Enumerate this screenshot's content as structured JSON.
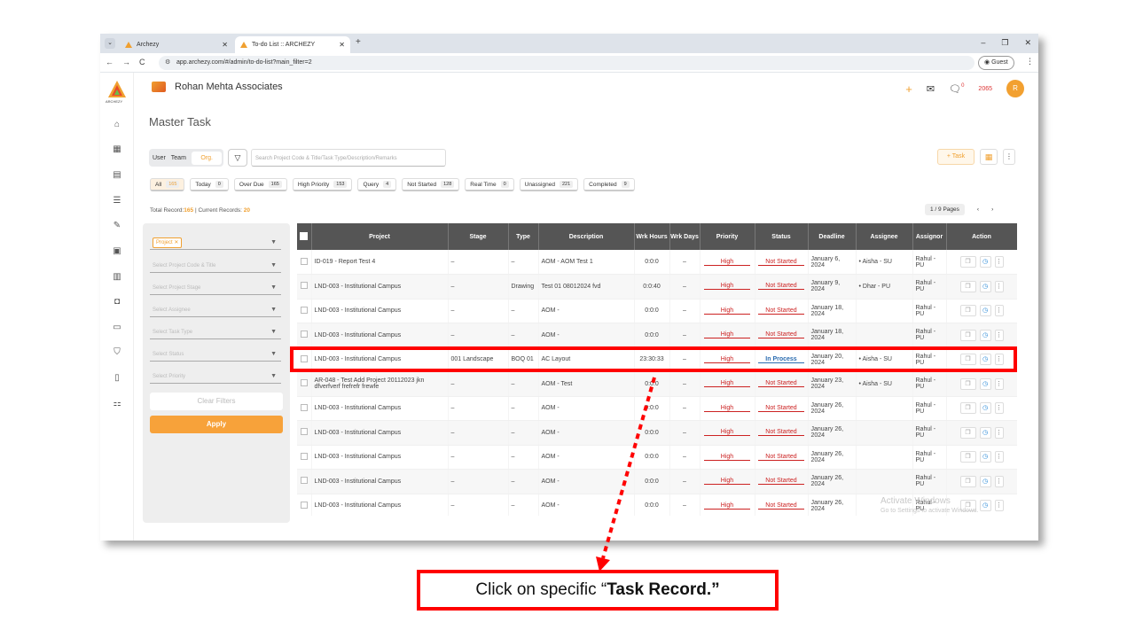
{
  "browser": {
    "tabs": [
      {
        "title": "Archezy"
      },
      {
        "title": "To-do List :: ARCHEZY"
      }
    ],
    "new_tab": "+",
    "window_controls": [
      "–",
      "❐",
      "✕"
    ],
    "url": "app.archezy.com/#/admin/to-do-list?main_filter=2",
    "guest_label": "Guest"
  },
  "app": {
    "brand_text": "ARCHEZY",
    "org_name": "Rohan Mehta Associates",
    "page_title": "Master Task",
    "notification_count": "0",
    "coins": "2065",
    "avatar_initial": "R"
  },
  "toolbar": {
    "toggle_user": "User",
    "toggle_team": "Team",
    "toggle_org": "Org.",
    "search_placeholder": "Search Project Code & Title/Task Type/Description/Remarks",
    "add_task_label": "+ Task"
  },
  "chips": [
    {
      "label": "All",
      "count": "165"
    },
    {
      "label": "Today",
      "count": "0"
    },
    {
      "label": "Over Due",
      "count": "165"
    },
    {
      "label": "High Priority",
      "count": "153"
    },
    {
      "label": "Query",
      "count": "4"
    },
    {
      "label": "Not Started",
      "count": "128"
    },
    {
      "label": "Real Time",
      "count": "0"
    },
    {
      "label": "Unassigned",
      "count": "221"
    },
    {
      "label": "Completed",
      "count": "9"
    }
  ],
  "totals": {
    "total_label": "Total Record:",
    "total_value": "165",
    "current_label": "| Current Records:",
    "current_value": "20"
  },
  "pagination": {
    "pages": "1 / 9 Pages",
    "prev": "‹",
    "next": "›"
  },
  "filters": {
    "project_tag": "Project",
    "selects": [
      "Select Project Code & Title",
      "Select Project Stage",
      "Select Assignee",
      "Select Task Type",
      "Select Status",
      "Select Priority"
    ],
    "clear_label": "Clear Filters",
    "apply_label": "Apply"
  },
  "table": {
    "headers": [
      "Project",
      "Stage",
      "Type",
      "Description",
      "Wrk Hours",
      "Wrk Days",
      "Priority",
      "Status",
      "Deadline",
      "Assignee",
      "Assignor",
      "Action"
    ],
    "rows": [
      {
        "project": "ID-019 - Report Test 4",
        "stage": "–",
        "type": "–",
        "description": "AOM - AOM Test 1",
        "hours": "0:0:0",
        "days": "–",
        "priority": "High",
        "status": "Not Started",
        "deadline": "January 6, 2024",
        "assignee": "Aisha - SU",
        "assignor": "Rahul - PU"
      },
      {
        "project": "LND-003 - Institutional Campus",
        "stage": "–",
        "type": "Drawing",
        "description": "Test 01 08012024 fvd",
        "hours": "0:0:40",
        "days": "–",
        "priority": "High",
        "status": "Not Started",
        "deadline": "January 9, 2024",
        "assignee": "Dhar - PU",
        "assignor": "Rahul - PU"
      },
      {
        "project": "LND-003 - Institutional Campus",
        "stage": "–",
        "type": "–",
        "description": "AOM -",
        "hours": "0:0:0",
        "days": "–",
        "priority": "High",
        "status": "Not Started",
        "deadline": "January 18, 2024",
        "assignee": "",
        "assignor": "Rahul - PU"
      },
      {
        "project": "LND-003 - Institutional Campus",
        "stage": "–",
        "type": "–",
        "description": "AOM -",
        "hours": "0:0:0",
        "days": "–",
        "priority": "High",
        "status": "Not Started",
        "deadline": "January 18, 2024",
        "assignee": "",
        "assignor": "Rahul - PU"
      },
      {
        "project": "LND-003 - Institutional Campus",
        "stage": "001 Landscape",
        "type": "BOQ 01",
        "description": "AC Layout",
        "hours": "23:30:33",
        "days": "–",
        "priority": "High",
        "status": "In Process",
        "deadline": "January 20, 2024",
        "assignee": "Aisha - SU",
        "assignor": "Rahul - PU"
      },
      {
        "project": "AR-048 - Test Add Project 20112023 jkn dfverfverf frefrefr frewfe",
        "stage": "–",
        "type": "–",
        "description": "AOM - Test",
        "hours": "0:0:0",
        "days": "–",
        "priority": "High",
        "status": "Not Started",
        "deadline": "January 23, 2024",
        "assignee": "Aisha - SU",
        "assignor": "Rahul - PU"
      },
      {
        "project": "LND-003 - Institutional Campus",
        "stage": "–",
        "type": "–",
        "description": "AOM -",
        "hours": "0:0:0",
        "days": "–",
        "priority": "High",
        "status": "Not Started",
        "deadline": "January 26, 2024",
        "assignee": "",
        "assignor": "Rahul - PU"
      },
      {
        "project": "LND-003 - Institutional Campus",
        "stage": "–",
        "type": "–",
        "description": "AOM -",
        "hours": "0:0:0",
        "days": "–",
        "priority": "High",
        "status": "Not Started",
        "deadline": "January 26, 2024",
        "assignee": "",
        "assignor": "Rahul - PU"
      },
      {
        "project": "LND-003 - Institutional Campus",
        "stage": "–",
        "type": "–",
        "description": "AOM -",
        "hours": "0:0:0",
        "days": "–",
        "priority": "High",
        "status": "Not Started",
        "deadline": "January 26, 2024",
        "assignee": "",
        "assignor": "Rahul - PU"
      },
      {
        "project": "LND-003 - Institutional Campus",
        "stage": "–",
        "type": "–",
        "description": "AOM -",
        "hours": "0:0:0",
        "days": "–",
        "priority": "High",
        "status": "Not Started",
        "deadline": "January 26, 2024",
        "assignee": "",
        "assignor": "Rahul - PU"
      },
      {
        "project": "LND-003 - Institutional Campus",
        "stage": "–",
        "type": "–",
        "description": "AOM -",
        "hours": "0:0:0",
        "days": "–",
        "priority": "High",
        "status": "Not Started",
        "deadline": "January 26, 2024",
        "assignee": "",
        "assignor": "Rahul - PU"
      }
    ]
  },
  "watermark": {
    "line1": "Activate Windows",
    "line2": "Go to Settings to activate Windows."
  },
  "callout": {
    "prefix": "Click on specific “",
    "bold": "Task Record.”"
  },
  "colors": {
    "accent": "#f0a030",
    "annotation": "#ff0000",
    "header_bg": "#555555",
    "high": "#cc2222",
    "in_process": "#2b6cb0"
  }
}
